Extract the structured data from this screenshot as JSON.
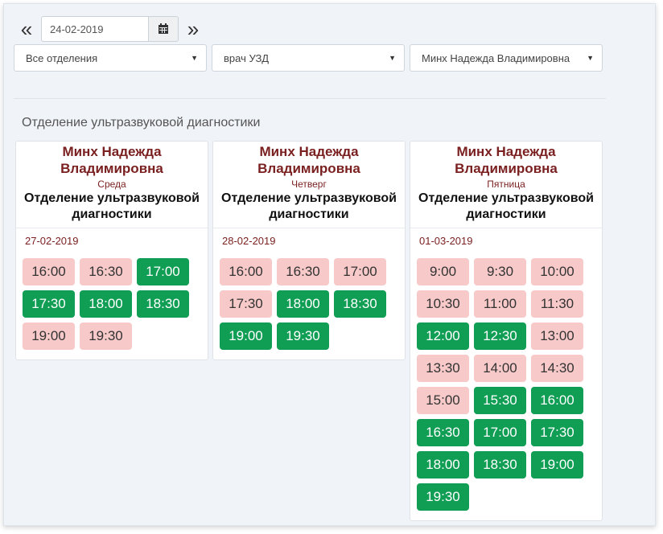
{
  "nav": {
    "date_value": "24-02-2019",
    "prev_icon": "double-chevron-left",
    "next_icon": "double-chevron-right",
    "calendar_icon": "calendar-icon"
  },
  "filters": {
    "department": "Все отделения",
    "specialty": "врач УЗД",
    "doctor": "Минх Надежда Владимировна"
  },
  "section_title": "Отделение ультразвуковой диагностики",
  "colors": {
    "busy": "#f7c9c9",
    "free": "#109d54",
    "doctor": "#7a1f1f"
  },
  "cards": [
    {
      "doctor": "Минх Надежда Владимировна",
      "weekday": "Среда",
      "department": "Отделение ультразвуковой диагностики",
      "date": "27-02-2019",
      "slots": [
        {
          "time": "16:00",
          "status": "busy"
        },
        {
          "time": "16:30",
          "status": "busy"
        },
        {
          "time": "17:00",
          "status": "free"
        },
        {
          "time": "17:30",
          "status": "free"
        },
        {
          "time": "18:00",
          "status": "free"
        },
        {
          "time": "18:30",
          "status": "free"
        },
        {
          "time": "19:00",
          "status": "busy"
        },
        {
          "time": "19:30",
          "status": "busy"
        }
      ]
    },
    {
      "doctor": "Минх Надежда Владимировна",
      "weekday": "Четверг",
      "department": "Отделение ультразвуковой диагностики",
      "date": "28-02-2019",
      "slots": [
        {
          "time": "16:00",
          "status": "busy"
        },
        {
          "time": "16:30",
          "status": "busy"
        },
        {
          "time": "17:00",
          "status": "busy"
        },
        {
          "time": "17:30",
          "status": "busy"
        },
        {
          "time": "18:00",
          "status": "free"
        },
        {
          "time": "18:30",
          "status": "free"
        },
        {
          "time": "19:00",
          "status": "free"
        },
        {
          "time": "19:30",
          "status": "free"
        }
      ]
    },
    {
      "doctor": "Минх Надежда Владимировна",
      "weekday": "Пятница",
      "department": "Отделение ультразвуковой диагностики",
      "date": "01-03-2019",
      "slots": [
        {
          "time": "9:00",
          "status": "busy"
        },
        {
          "time": "9:30",
          "status": "busy"
        },
        {
          "time": "10:00",
          "status": "busy"
        },
        {
          "time": "10:30",
          "status": "busy"
        },
        {
          "time": "11:00",
          "status": "busy"
        },
        {
          "time": "11:30",
          "status": "busy"
        },
        {
          "time": "12:00",
          "status": "free"
        },
        {
          "time": "12:30",
          "status": "free"
        },
        {
          "time": "13:00",
          "status": "busy"
        },
        {
          "time": "13:30",
          "status": "busy"
        },
        {
          "time": "14:00",
          "status": "busy"
        },
        {
          "time": "14:30",
          "status": "busy"
        },
        {
          "time": "15:00",
          "status": "busy"
        },
        {
          "time": "15:30",
          "status": "free"
        },
        {
          "time": "16:00",
          "status": "free"
        },
        {
          "time": "16:30",
          "status": "free"
        },
        {
          "time": "17:00",
          "status": "free"
        },
        {
          "time": "17:30",
          "status": "free"
        },
        {
          "time": "18:00",
          "status": "free"
        },
        {
          "time": "18:30",
          "status": "free"
        },
        {
          "time": "19:00",
          "status": "free"
        },
        {
          "time": "19:30",
          "status": "free"
        }
      ]
    }
  ]
}
